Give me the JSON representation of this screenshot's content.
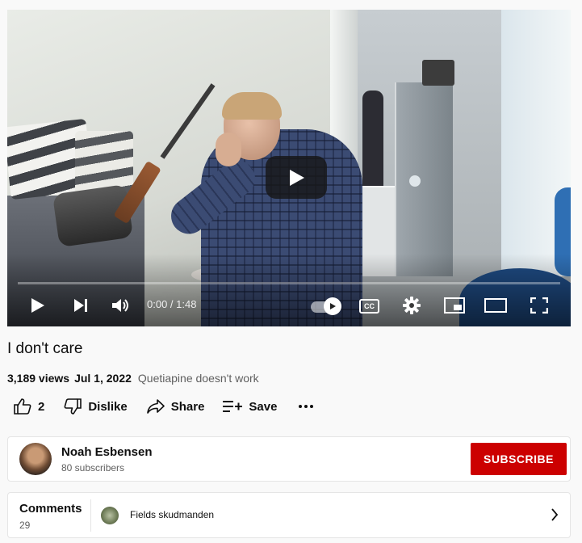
{
  "player": {
    "time": "0:00 / 1:48",
    "progress_fraction": 0.0,
    "cc_label": "CC",
    "icons": [
      "play-icon",
      "next-icon",
      "volume-icon",
      "autoplay-toggle-icon",
      "captions-icon",
      "settings-gear-icon",
      "miniplayer-icon",
      "theater-mode-icon",
      "fullscreen-icon"
    ]
  },
  "video": {
    "title": "I don't care",
    "views": "3,189 views",
    "date": "Jul 1, 2022",
    "description": "Quetiapine doesn't work"
  },
  "actions": {
    "like_count": "2",
    "dislike_label": "Dislike",
    "share_label": "Share",
    "save_label": "Save",
    "more_label": "..."
  },
  "channel": {
    "name": "Noah Esbensen",
    "subscribers": "80 subscribers",
    "subscribe_label": "SUBSCRIBE"
  },
  "comments": {
    "label": "Comments",
    "count": "29",
    "preview_text": "Fields skudmanden"
  },
  "colors": {
    "accent": "#cc0000",
    "background": "#f9f9f9",
    "secondary_text": "#606060"
  }
}
